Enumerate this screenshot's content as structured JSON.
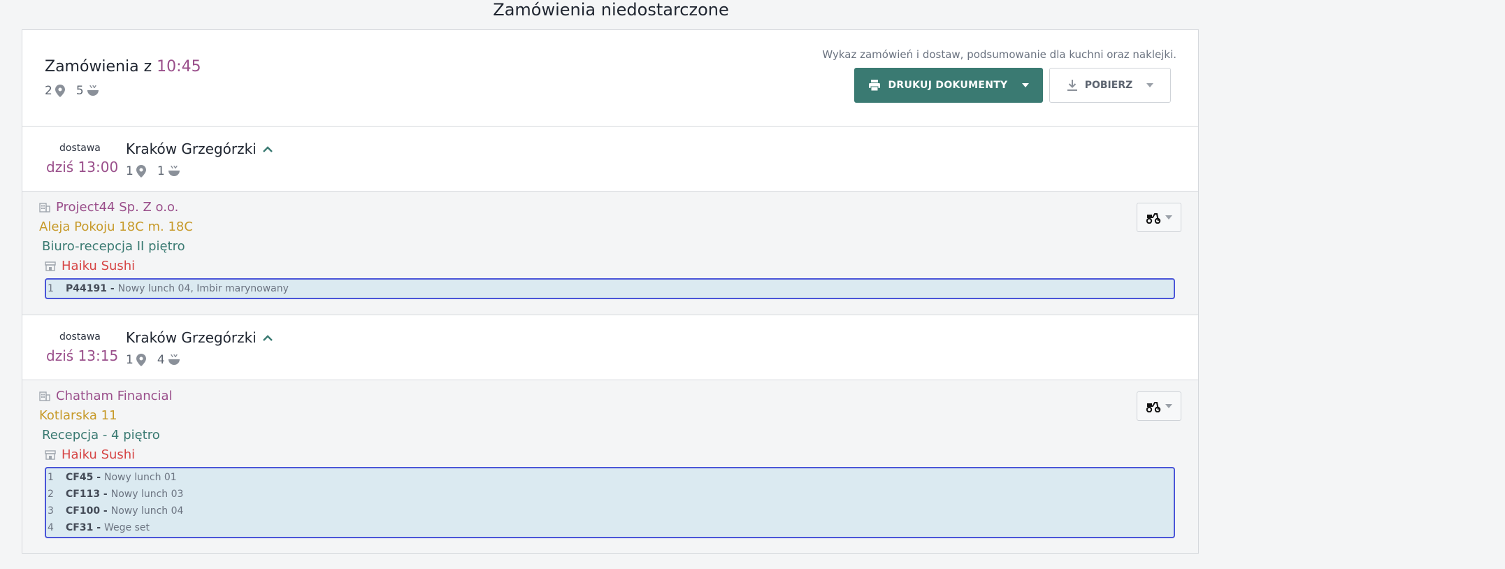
{
  "page": {
    "title": "Zamówienia niedostarczone"
  },
  "summary": {
    "title_prefix": "Zamówienia z",
    "time": "10:45",
    "locations_count": "2",
    "meals_count": "5",
    "hint": "Wykaz zamówień i dostaw, podsumowanie dla kuchni oraz naklejki.",
    "print_label": "DRUKUJ DOKUMENTY",
    "download_label": "POBIERZ"
  },
  "deliveries": [
    {
      "type": "dostawa",
      "time": "dziś 13:00",
      "location": "Kraków Grzegórzki",
      "locations_count": "1",
      "meals_count": "1",
      "company": "Project44 Sp. Z o.o.",
      "address": "Aleja Pokoju 18C m. 18C",
      "place": "Biuro-recepcja II piętro",
      "restaurant": "Haiku Sushi",
      "items": [
        {
          "idx": "1",
          "code": "P44191 -",
          "desc": "Nowy lunch 04, Imbir marynowany"
        }
      ]
    },
    {
      "type": "dostawa",
      "time": "dziś 13:15",
      "location": "Kraków Grzegórzki",
      "locations_count": "1",
      "meals_count": "4",
      "company": "Chatham Financial",
      "address": "Kotlarska 11",
      "place": "Recepcja - 4 piętro",
      "restaurant": "Haiku Sushi",
      "items": [
        {
          "idx": "1",
          "code": "CF45 -",
          "desc": "Nowy lunch 01"
        },
        {
          "idx": "2",
          "code": "CF113 -",
          "desc": "Nowy lunch 03"
        },
        {
          "idx": "3",
          "code": "CF100 -",
          "desc": "Nowy lunch 04"
        },
        {
          "idx": "4",
          "code": "CF31 -",
          "desc": "Wege set"
        }
      ]
    }
  ],
  "colors": {
    "accent_purple": "#9a4f8b",
    "primary_green": "#3a7a72",
    "address_gold": "#c79a2a",
    "restaurant_red": "#d64545",
    "items_border": "#4a55d8",
    "items_bg": "#dbeaf1"
  },
  "icons": {
    "location": "map-pin-icon",
    "meals": "bowl-icon",
    "print": "printer-icon",
    "download": "download-icon",
    "company": "building-icon",
    "restaurant": "store-icon",
    "courier": "scooter-icon",
    "collapse": "chevron-up-icon"
  }
}
